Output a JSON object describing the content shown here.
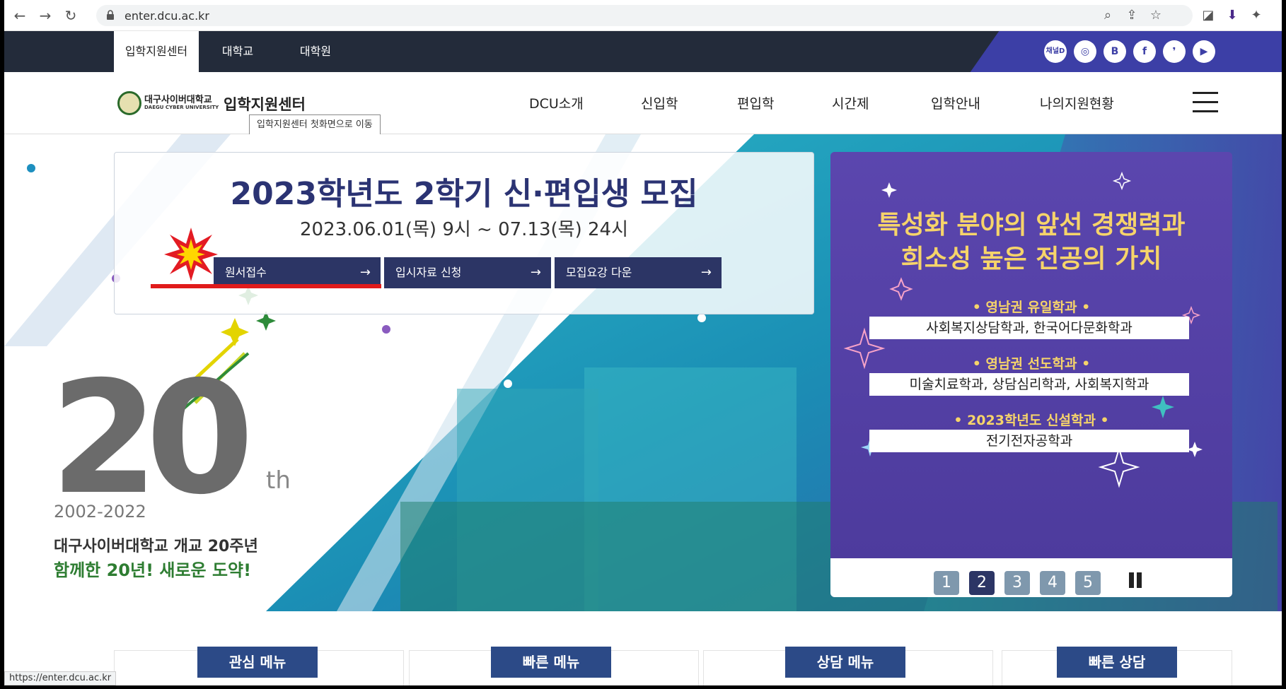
{
  "browser": {
    "url": "enter.dcu.ac.kr",
    "status_url": "https://enter.dcu.ac.kr"
  },
  "topbar": {
    "tabs": [
      "입학지원센터",
      "대학교",
      "대학원"
    ],
    "social": [
      "채널D",
      "instagram-icon",
      "blog-icon",
      "facebook-icon",
      "kakao-icon",
      "youtube-icon"
    ]
  },
  "header": {
    "logo_korean": "대구사이버대학교",
    "logo_english": "DAEGU CYBER UNIVERSITY",
    "logo_center": "입학지원센터",
    "tooltip": "입학지원센터 첫화면으로 이동",
    "nav": [
      "DCU소개",
      "신입학",
      "편입학",
      "시간제",
      "입학안내",
      "나의지원현황"
    ]
  },
  "hero": {
    "title": "2023학년도 2학기 신·편입생 모집",
    "date": "2023.06.01(목) 9시 ~ 07.13(목) 24시",
    "buttons": [
      "원서접수",
      "입시자료 신청",
      "모집요강 다운"
    ],
    "arrow": "→",
    "anniversary": {
      "number": "20",
      "suffix": "th",
      "years": "2002-2022",
      "line1": "대구사이버대학교 개교 20주년",
      "line2": "함께한 20년! 새로운 도약!"
    },
    "panel": {
      "headline1": "특성화 분야의 앞선 경쟁력과",
      "headline2": "희소성 높은 전공의 가치",
      "sections": [
        {
          "label": "• 영남권 유일학과 •",
          "content": "사회복지상담학과, 한국어다문화학과"
        },
        {
          "label": "• 영남권 선도학과 •",
          "content": "미술치료학과, 상담심리학과, 사회복지학과"
        },
        {
          "label": "• 2023학년도 신설학과 •",
          "content": "전기전자공학과"
        }
      ],
      "pages": [
        "1",
        "2",
        "3",
        "4",
        "5"
      ],
      "active_page": 2
    }
  },
  "quick_menus": [
    "관심 메뉴",
    "빠른 메뉴",
    "상담 메뉴",
    "빠른 상담"
  ],
  "colors": {
    "navy": "#2c3565",
    "purple": "#5a44a8",
    "gold": "#f6d46a",
    "topbar": "#232b3a"
  }
}
